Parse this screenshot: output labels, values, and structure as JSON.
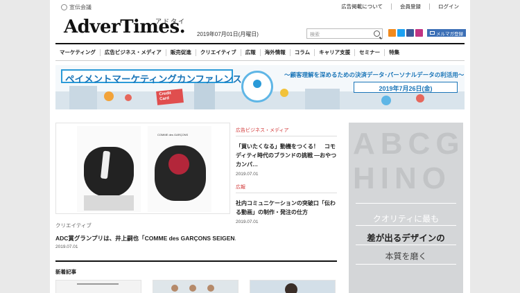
{
  "header": {
    "brand_small": "宣伝会議",
    "utility_links": [
      "広告掲載について",
      "会員登録",
      "ログイン"
    ],
    "logo": "AdverTimes.",
    "logo_kana": "アドタイ",
    "date": "2019年07月01日(月曜日)",
    "search_placeholder": "検索",
    "mail_magazine": "メルマガ登録"
  },
  "nav": {
    "items": [
      "マーケティング",
      "広告ビジネス・メディア",
      "販売促進",
      "クリエイティブ",
      "広報",
      "海外情報",
      "コラム",
      "キャリア支援",
      "セミナー",
      "特集"
    ]
  },
  "banner": {
    "title": "ペイメントマーケティングカンファレンス",
    "subtitle": "〜顧客理解を深めるための決済データ･パーソナルデータの利活用〜",
    "event_date": "2019年7月26日(金)",
    "card_text": "Credit Card"
  },
  "feature": {
    "poster_text": "COMME des GARÇONS",
    "category": "クリエイティブ",
    "title": "ADC賞グランプリは、井上嗣也「COMME des GARÇONS SEIGEN…",
    "date": "2019.07.01"
  },
  "side_articles": [
    {
      "category": "広告ビジネス・メディア",
      "title": "「買いたくなる」動機をつくる！　コモディティ時代のブランドの挑戦 ―おやつカンパ…",
      "date": "2019.07.01"
    },
    {
      "category": "広報",
      "title": "社内コミュニケーションの突破口「伝わる動画」の制作・発注の仕方",
      "date": "2019.07.01"
    }
  ],
  "ad": {
    "bg_letters": "ABCGHINO",
    "line1": "クオリティに最も",
    "line2": "差が出るデザインの",
    "line3": "本質を磨く"
  },
  "new_articles": {
    "heading": "新着記事"
  },
  "colors": {
    "accent_red": "#d23a3a",
    "banner_blue": "#1a75b8",
    "mail_blue": "#3b6fb6"
  }
}
